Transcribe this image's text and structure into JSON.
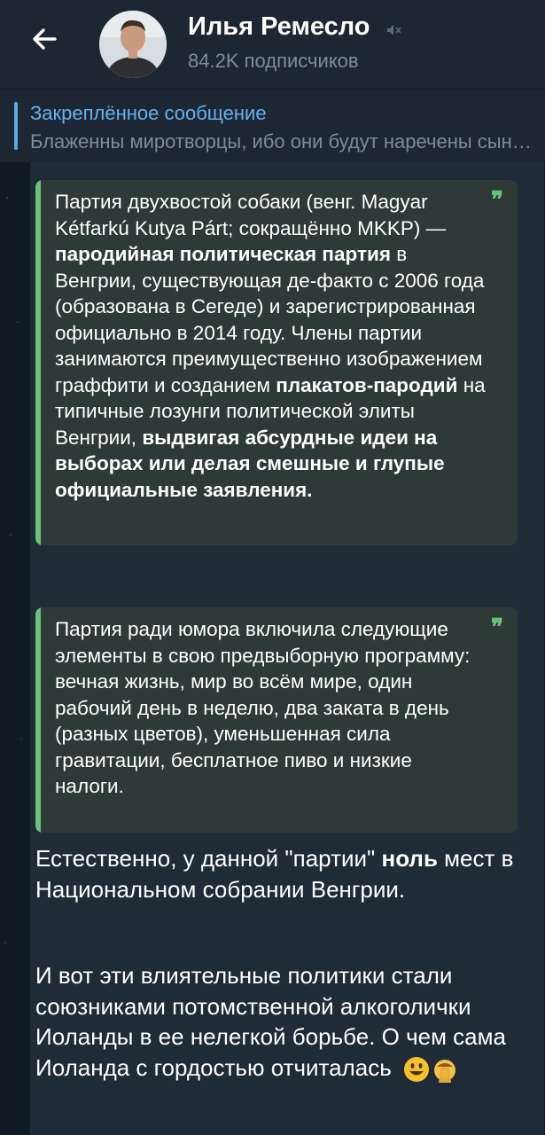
{
  "header": {
    "title": "Илья Ремесло",
    "subscribers": "84.2K подписчиков",
    "icons": [
      "back-arrow-icon",
      "mute-icon",
      "avatar"
    ]
  },
  "pinned": {
    "title": "Закреплённое сообщение",
    "text": "Блаженны миротворцы, ибо они будут наречены сынами Божиими"
  },
  "message": {
    "quote1": {
      "t1": "Партия двухвостой собаки (венг. Magyar Kétfarkú Kutya Párt; сокращённо MKKP) — ",
      "b1": "пародийная политическая партия",
      "t2": " в Венгрии, существующая де-факто с 2006 года (образована в Сегеде) и зарегистрированная официально в 2014 году. Члены партии занимаются преимущественно изображением граффити и созданием ",
      "b2": "плакатов-пародий",
      "t3": " на типичные лозунги политической элиты Венгрии, ",
      "b3": "выдвигая абсурдные идеи на выборах или делая смешные и глупые официальные заявления."
    },
    "quote2": {
      "text": "Партия ради юмора включила следующие элементы в свою предвыборную программу: вечная жизнь, мир во всём мире, один рабочий день в неделю, два заката в день (разных цветов), уменьшенная сила гравитации, бесплатное пиво и низкие налоги."
    },
    "para1": {
      "t1": "Естественно, у данной \"партии\" ",
      "b1": "ноль",
      "t2": " мест в Национальном собрании Венгрии."
    },
    "para2": {
      "text": "И вот эти влиятельные политики стали союзниками потомственной алкоголички Иоланды в ее нелегкой борьбе. О чем сама Иоланда с гордостью отчиталась"
    },
    "quote_mark": "❞",
    "emojis": [
      "smiley-emoji",
      "facepalm-emoji"
    ]
  },
  "colors": {
    "header_bg": "#1d2733",
    "chat_bg": "#0f1a24",
    "bubble_bg": "#1f2b37",
    "quote_bg": "#2d3a38",
    "quote_accent": "#6cc07b",
    "link_blue": "#64b2f0",
    "secondary_text": "#7e8b98"
  }
}
